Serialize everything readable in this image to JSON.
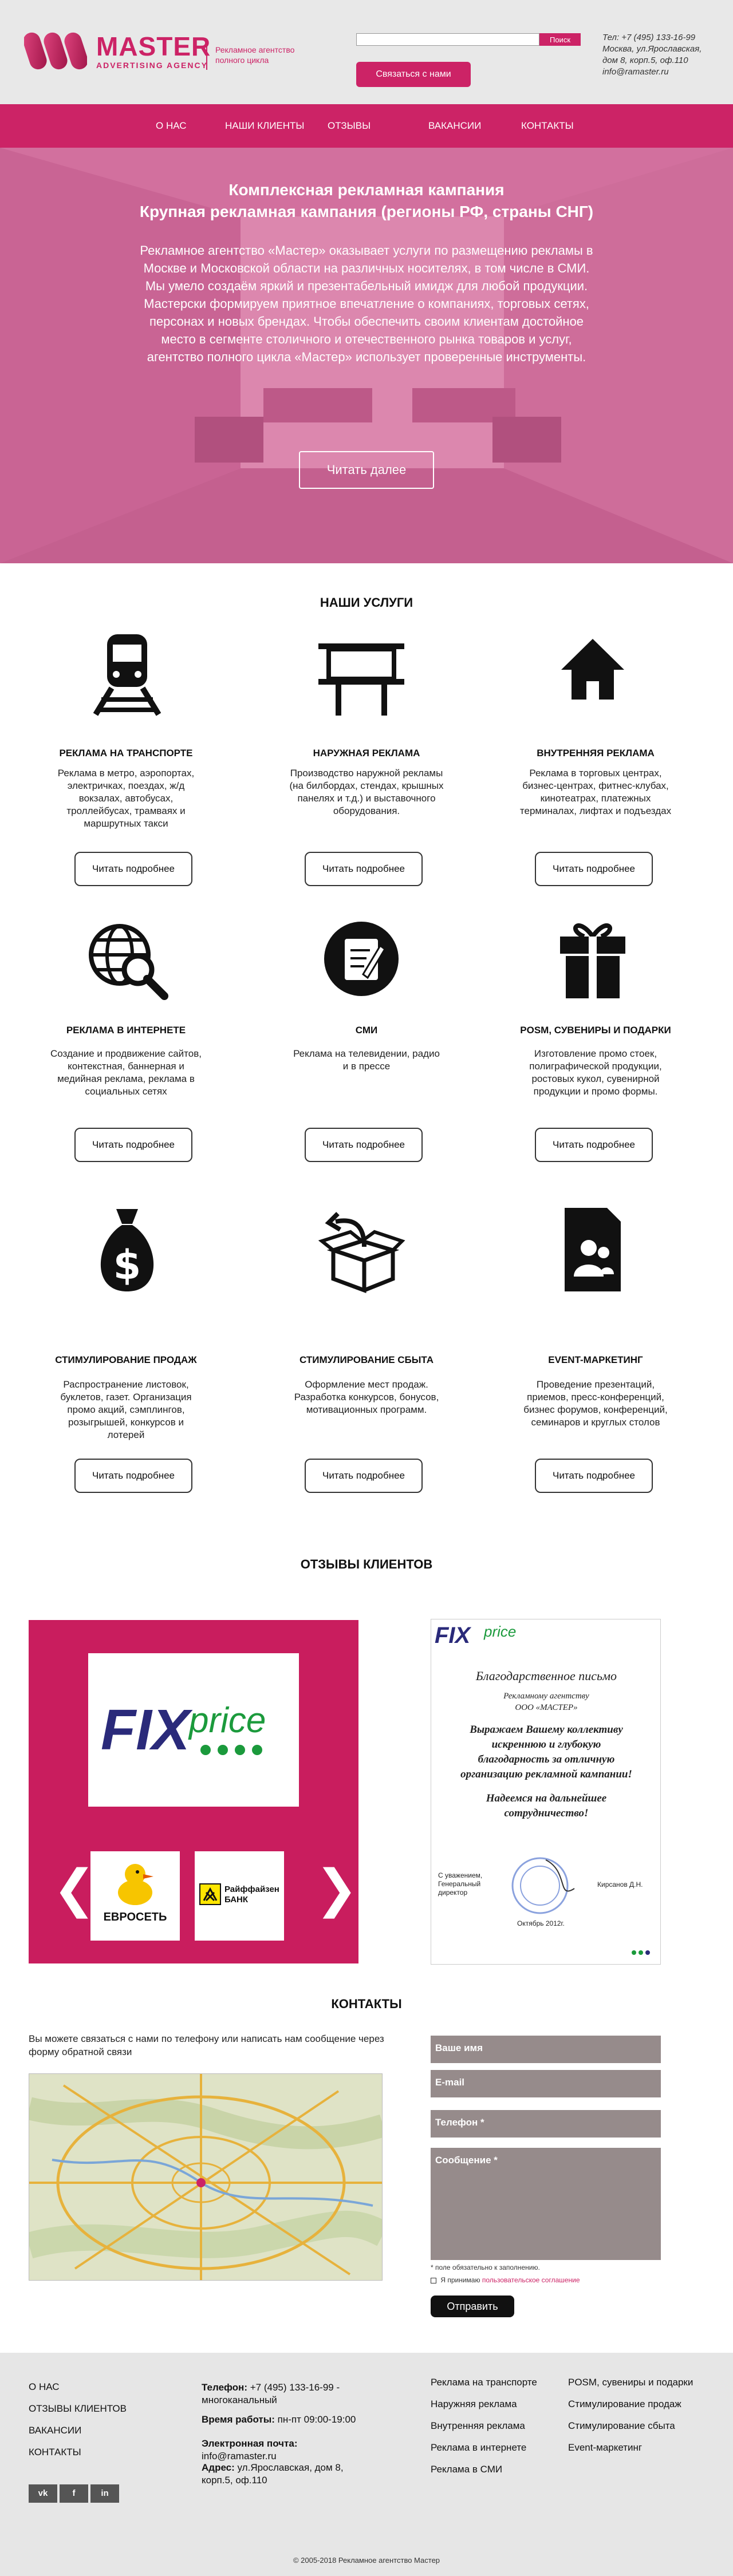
{
  "header": {
    "logo_title": "MASTER",
    "logo_subtitle": "ADVERTISING AGENCY",
    "logo_tagline": "Рекламное агентство полного цикла",
    "search_placeholder": "",
    "search_button": "Поиск",
    "contact_button": "Связаться с нами",
    "phone": "Тел: +7 (495) 133-16-99",
    "address_line1": "Москва, ул.Ярославская,",
    "address_line2": "дом 8, корп.5, оф.110",
    "email": "info@ramaster.ru",
    "brand_color": "#cc2366"
  },
  "nav": {
    "items": [
      "О НАС",
      "НАШИ КЛИЕНТЫ",
      "ОТЗЫВЫ",
      "ВАКАНСИИ",
      "КОНТАКТЫ"
    ]
  },
  "hero": {
    "title_line1": "Комплексная рекламная кампания",
    "title_line2": "Крупная рекламная кампания (регионы РФ, страны СНГ)",
    "text": "Рекламное агентство «Мастер» оказывает услуги по размещению рекламы в Москве и Московской области на различных носителях, в том числе в СМИ. Мы умело создаём яркий и презентабельный имидж для любой продукции. Мастерски формируем  приятное впечатление о компаниях, торговых сетях, персонах и новых брендах. Чтобы обеспечить своим клиентам достойное место в сегменте столичного и отечественного рынка товаров и услуг, агентство полного цикла «Мастер» использует проверенные инструменты.",
    "button": "Читать далее"
  },
  "services": {
    "title": "НАШИ УСЛУГИ",
    "read_more": "Читать подробнее",
    "items": [
      {
        "title": "РЕКЛАМА НА ТРАНСПОРТЕ",
        "desc": "Реклама в метро, аэропортах, электричках, поездах, ж/д вокзалах, автобусах, троллейбусах, трамваях и маршрутных такси",
        "icon": "train-icon"
      },
      {
        "title": "НАРУЖНАЯ РЕКЛАМА",
        "desc": "Производство наружной рекламы (на билбордах, стендах, крышных панелях и т.д.) и выставочного оборудования.",
        "icon": "billboard-icon"
      },
      {
        "title": "ВНУТРЕННЯЯ РЕКЛАМА",
        "desc": "Реклама в торговых центрах, бизнес-центрах, фитнес-клубах, кинотеатрах, платежных терминалах, лифтах и подъездах",
        "icon": "house-icon"
      },
      {
        "title": "РЕКЛАМА В ИНТЕРНЕТЕ",
        "desc": "Создание и продвижение сайтов, контекстная, баннерная и медийная реклама, реклама в социальных сетях",
        "icon": "globe-search-icon"
      },
      {
        "title": "СМИ",
        "desc": "Реклама на телевидении, радио и в прессе",
        "icon": "pencil-note-icon"
      },
      {
        "title": "POSM, СУВЕНИРЫ И ПОДАРКИ",
        "desc": "Изготовление промо стоек, полиграфической продукции, ростовых кукол, сувенирной продукции и промо формы.",
        "icon": "gift-icon"
      },
      {
        "title": "СТИМУЛИРОВАНИЕ ПРОДАЖ",
        "desc": "Распространение листовок, буклетов, газет. Организация промо акций, сэмплингов, розыгрышей, конкурсов и лотерей",
        "icon": "money-bag-icon"
      },
      {
        "title": "СТИМУЛИРОВАНИЕ СБЫТА",
        "desc": "Оформление мест продаж. Разработка конкурсов, бонусов, мотивационных программ.",
        "icon": "open-box-icon"
      },
      {
        "title": "EVENT-МАРКЕТИНГ",
        "desc": "Проведение презентаций, приемов, пресс-конференций, бизнес форумов, конференций, семинаров и круглых столов",
        "icon": "file-people-icon"
      }
    ]
  },
  "reviews": {
    "title": "ОТЗЫВЫ КЛИЕНТОВ",
    "main_logo_fix": "FIX",
    "main_logo_price": "price",
    "thumb1": "ЕВРОСЕТЬ",
    "thumb2_line1": "Райффайзен",
    "thumb2_line2": "БАНК",
    "arrow_left": "❮",
    "arrow_right": "❯",
    "letter": {
      "heading": "Благодарственное письмо",
      "to_line1": "Рекламному агентству",
      "to_line2": "ООО «МАСТЕР»",
      "body": "Выражаем Вашему коллективу искреннюю и глубокую благодарность за отличную организацию рекламной кампании!",
      "wish": "Надеемся на дальнейшее сотрудничество!",
      "sign_left": "С уважением, Генеральный директор",
      "sign_right": "Кирсанов Д.Н.",
      "date": "Октябрь 2012г."
    }
  },
  "contacts": {
    "title": "КОНТАКТЫ",
    "intro": "Вы можете связаться с нами по телефону или написать нам сообщение через форму обратной связи",
    "form": {
      "name": "Ваше имя",
      "email": "E-mail",
      "phone": "Телефон *",
      "message": "Сообщение *",
      "required_note": "* поле обязательно к заполнению.",
      "consent_prefix": "Я принимаю",
      "consent_link": "пользовательское соглашение",
      "submit": "Отправить"
    }
  },
  "footer": {
    "menu": [
      "О НАС",
      "ОТЗЫВЫ КЛИЕНТОВ",
      "ВАКАНСИИ",
      "КОНТАКТЫ"
    ],
    "phone_label": "Телефон:",
    "phone_value": "+7 (495) 133-16-99 - многоканальный",
    "hours_label": "Время работы:",
    "hours_value": "пн-пт 09:00-19:00",
    "email_label": "Электронная почта:",
    "email_value": "info@ramaster.ru",
    "address_label": "Адрес:",
    "address_value": "ул.Ярославская, дом 8, корп.5, оф.110",
    "services_col1": [
      "Реклама на транспорте",
      "Наружняя реклама",
      "Внутренняя реклама",
      "Реклама в интернете",
      "Реклама в СМИ"
    ],
    "services_col2": [
      "POSM, сувениры и подарки",
      "Стимулирование продаж",
      "Стимулирование сбыта",
      "Event-маркетинг"
    ],
    "social": [
      "vk",
      "f",
      "in"
    ],
    "copyright": "© 2005-2018 Рекламное агентство Мастер"
  }
}
